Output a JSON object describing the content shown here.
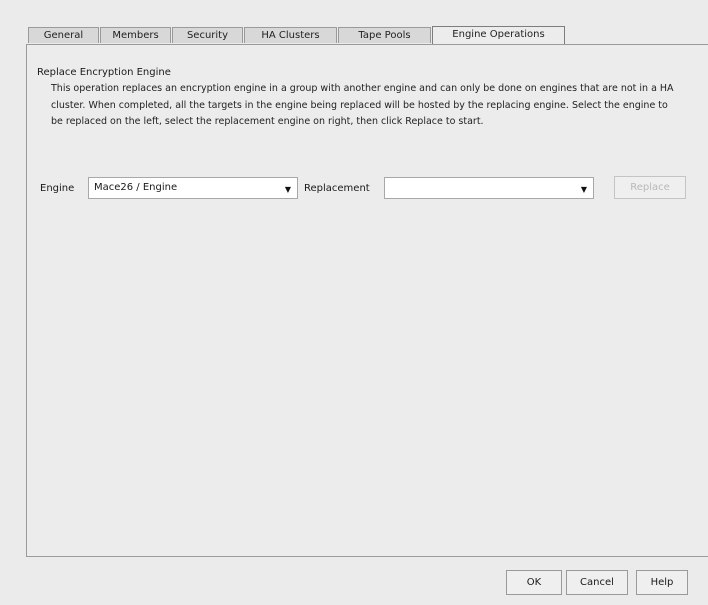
{
  "tabs": [
    "General",
    "Members",
    "Security",
    "HA Clusters",
    "Tape Pools",
    "Engine Operations"
  ],
  "active_tab": "Engine Operations",
  "section": {
    "title": "Replace Encryption Engine",
    "description": "This operation replaces an encryption engine in a group with another engine and can only be done on engines that are not in a HA cluster. When completed, all the targets in the engine being replaced will be hosted by the replacing engine. Select the engine to be replaced on the left, select the replacement engine on right, then click Replace to start."
  },
  "form": {
    "engine_label": "Engine",
    "engine_value": "Mace26 / Engine",
    "replacement_label": "Replacement",
    "replacement_value": "",
    "replace_button": "Replace"
  },
  "footer": {
    "ok": "OK",
    "cancel": "Cancel",
    "help": "Help"
  }
}
